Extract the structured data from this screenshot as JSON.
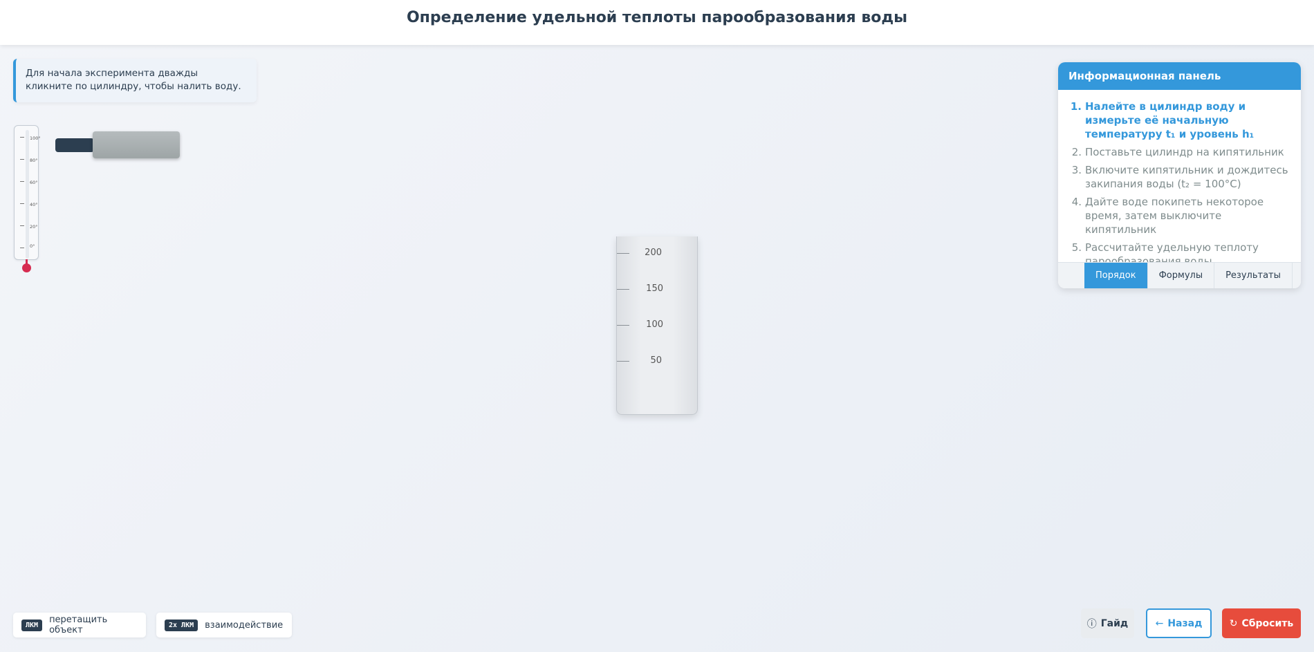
{
  "header": {
    "title": "Определение удельной теплоты парообразования воды"
  },
  "hint": {
    "text": "Для начала эксперимента дважды кликните по цилиндру, чтобы налить воду."
  },
  "thermometer": {
    "labels": [
      "100°",
      "80°",
      "60°",
      "40°",
      "20°",
      "0°"
    ],
    "color": "#d62b50"
  },
  "cylinder": {
    "labels": [
      "200",
      "150",
      "100",
      "50"
    ]
  },
  "info_panel": {
    "title": "Информационная панель",
    "steps": [
      {
        "num": "1.",
        "text": "Налейте в цилиндр воду и измерьте её начальную температуру t₁ и уровень h₁"
      },
      {
        "num": "2.",
        "text": "Поставьте цилиндр на кипятильник"
      },
      {
        "num": "3.",
        "text": "Включите кипятильник и дождитесь закипания воды (t₂ = 100°C)"
      },
      {
        "num": "4.",
        "text": "Дайте воде покипеть некоторое время, затем выключите кипятильник"
      },
      {
        "num": "5.",
        "text": "Рассчитайте удельную теплоту парообразования воды"
      }
    ],
    "active_step": 1,
    "tabs": [
      "Порядок",
      "Формулы",
      "Результаты"
    ]
  },
  "hotkeys": [
    {
      "key": "ЛКМ",
      "label": "перетащить объект"
    },
    {
      "key": "2x ЛКМ",
      "label": "взаимодействие"
    }
  ],
  "buttons": {
    "guide": {
      "label": "Гайд",
      "icon": "info-icon"
    },
    "back": {
      "label": "Назад",
      "icon": "arrow-left-icon"
    },
    "reset": {
      "label": "Сбросить",
      "icon": "reset-icon"
    }
  },
  "colors": {
    "accent": "#3498db",
    "danger": "#e74c3c",
    "dark": "#2c3e50"
  }
}
